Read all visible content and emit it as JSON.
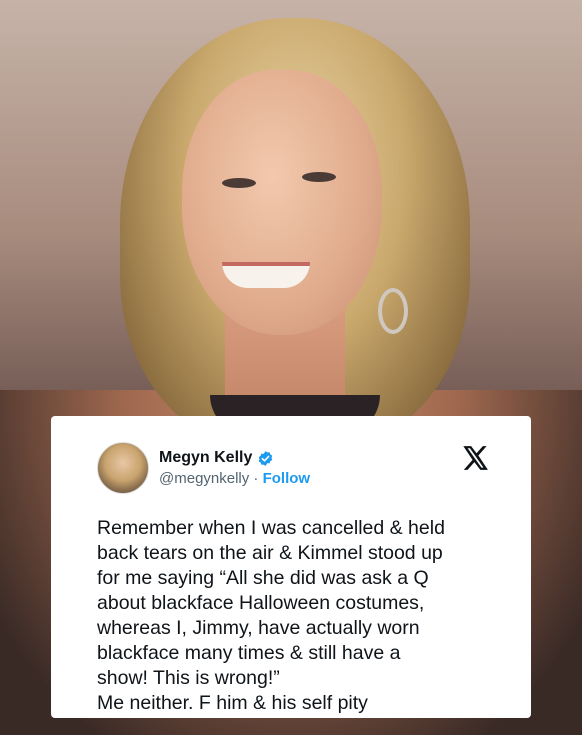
{
  "tweet": {
    "author_name": "Megyn Kelly",
    "handle": "@megynkelly",
    "separator": " · ",
    "follow_label": "Follow",
    "text_lines": [
      "Remember when I was cancelled & held",
      "back tears on the air & Kimmel stood up",
      "for me saying “All she did was ask a Q",
      "about blackface Halloween costumes,",
      "whereas I, Jimmy, have actually worn",
      "blackface many times & still have a",
      "show! This is wrong!”",
      "Me neither. F him & his self pity"
    ],
    "verified_icon": "verified-badge-icon",
    "platform_icon": "x-logo-icon"
  },
  "colors": {
    "follow_blue": "#1d9bf0",
    "handle_gray": "#536471",
    "text_dark": "#0f1419"
  }
}
